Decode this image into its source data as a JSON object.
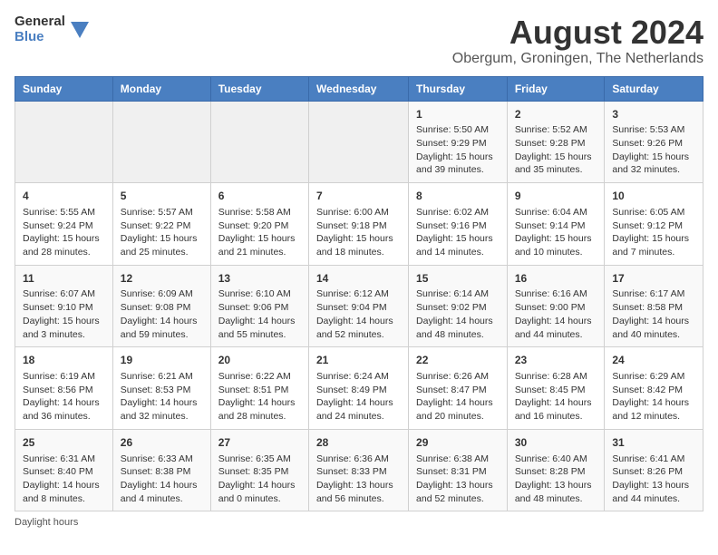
{
  "header": {
    "logo_general": "General",
    "logo_blue": "Blue",
    "month_title": "August 2024",
    "location": "Obergum, Groningen, The Netherlands"
  },
  "days_of_week": [
    "Sunday",
    "Monday",
    "Tuesday",
    "Wednesday",
    "Thursday",
    "Friday",
    "Saturday"
  ],
  "weeks": [
    [
      {
        "day": "",
        "info": ""
      },
      {
        "day": "",
        "info": ""
      },
      {
        "day": "",
        "info": ""
      },
      {
        "day": "",
        "info": ""
      },
      {
        "day": "1",
        "info": "Sunrise: 5:50 AM\nSunset: 9:29 PM\nDaylight: 15 hours\nand 39 minutes."
      },
      {
        "day": "2",
        "info": "Sunrise: 5:52 AM\nSunset: 9:28 PM\nDaylight: 15 hours\nand 35 minutes."
      },
      {
        "day": "3",
        "info": "Sunrise: 5:53 AM\nSunset: 9:26 PM\nDaylight: 15 hours\nand 32 minutes."
      }
    ],
    [
      {
        "day": "4",
        "info": "Sunrise: 5:55 AM\nSunset: 9:24 PM\nDaylight: 15 hours\nand 28 minutes."
      },
      {
        "day": "5",
        "info": "Sunrise: 5:57 AM\nSunset: 9:22 PM\nDaylight: 15 hours\nand 25 minutes."
      },
      {
        "day": "6",
        "info": "Sunrise: 5:58 AM\nSunset: 9:20 PM\nDaylight: 15 hours\nand 21 minutes."
      },
      {
        "day": "7",
        "info": "Sunrise: 6:00 AM\nSunset: 9:18 PM\nDaylight: 15 hours\nand 18 minutes."
      },
      {
        "day": "8",
        "info": "Sunrise: 6:02 AM\nSunset: 9:16 PM\nDaylight: 15 hours\nand 14 minutes."
      },
      {
        "day": "9",
        "info": "Sunrise: 6:04 AM\nSunset: 9:14 PM\nDaylight: 15 hours\nand 10 minutes."
      },
      {
        "day": "10",
        "info": "Sunrise: 6:05 AM\nSunset: 9:12 PM\nDaylight: 15 hours\nand 7 minutes."
      }
    ],
    [
      {
        "day": "11",
        "info": "Sunrise: 6:07 AM\nSunset: 9:10 PM\nDaylight: 15 hours\nand 3 minutes."
      },
      {
        "day": "12",
        "info": "Sunrise: 6:09 AM\nSunset: 9:08 PM\nDaylight: 14 hours\nand 59 minutes."
      },
      {
        "day": "13",
        "info": "Sunrise: 6:10 AM\nSunset: 9:06 PM\nDaylight: 14 hours\nand 55 minutes."
      },
      {
        "day": "14",
        "info": "Sunrise: 6:12 AM\nSunset: 9:04 PM\nDaylight: 14 hours\nand 52 minutes."
      },
      {
        "day": "15",
        "info": "Sunrise: 6:14 AM\nSunset: 9:02 PM\nDaylight: 14 hours\nand 48 minutes."
      },
      {
        "day": "16",
        "info": "Sunrise: 6:16 AM\nSunset: 9:00 PM\nDaylight: 14 hours\nand 44 minutes."
      },
      {
        "day": "17",
        "info": "Sunrise: 6:17 AM\nSunset: 8:58 PM\nDaylight: 14 hours\nand 40 minutes."
      }
    ],
    [
      {
        "day": "18",
        "info": "Sunrise: 6:19 AM\nSunset: 8:56 PM\nDaylight: 14 hours\nand 36 minutes."
      },
      {
        "day": "19",
        "info": "Sunrise: 6:21 AM\nSunset: 8:53 PM\nDaylight: 14 hours\nand 32 minutes."
      },
      {
        "day": "20",
        "info": "Sunrise: 6:22 AM\nSunset: 8:51 PM\nDaylight: 14 hours\nand 28 minutes."
      },
      {
        "day": "21",
        "info": "Sunrise: 6:24 AM\nSunset: 8:49 PM\nDaylight: 14 hours\nand 24 minutes."
      },
      {
        "day": "22",
        "info": "Sunrise: 6:26 AM\nSunset: 8:47 PM\nDaylight: 14 hours\nand 20 minutes."
      },
      {
        "day": "23",
        "info": "Sunrise: 6:28 AM\nSunset: 8:45 PM\nDaylight: 14 hours\nand 16 minutes."
      },
      {
        "day": "24",
        "info": "Sunrise: 6:29 AM\nSunset: 8:42 PM\nDaylight: 14 hours\nand 12 minutes."
      }
    ],
    [
      {
        "day": "25",
        "info": "Sunrise: 6:31 AM\nSunset: 8:40 PM\nDaylight: 14 hours\nand 8 minutes."
      },
      {
        "day": "26",
        "info": "Sunrise: 6:33 AM\nSunset: 8:38 PM\nDaylight: 14 hours\nand 4 minutes."
      },
      {
        "day": "27",
        "info": "Sunrise: 6:35 AM\nSunset: 8:35 PM\nDaylight: 14 hours\nand 0 minutes."
      },
      {
        "day": "28",
        "info": "Sunrise: 6:36 AM\nSunset: 8:33 PM\nDaylight: 13 hours\nand 56 minutes."
      },
      {
        "day": "29",
        "info": "Sunrise: 6:38 AM\nSunset: 8:31 PM\nDaylight: 13 hours\nand 52 minutes."
      },
      {
        "day": "30",
        "info": "Sunrise: 6:40 AM\nSunset: 8:28 PM\nDaylight: 13 hours\nand 48 minutes."
      },
      {
        "day": "31",
        "info": "Sunrise: 6:41 AM\nSunset: 8:26 PM\nDaylight: 13 hours\nand 44 minutes."
      }
    ]
  ],
  "footer": {
    "note": "Daylight hours"
  }
}
